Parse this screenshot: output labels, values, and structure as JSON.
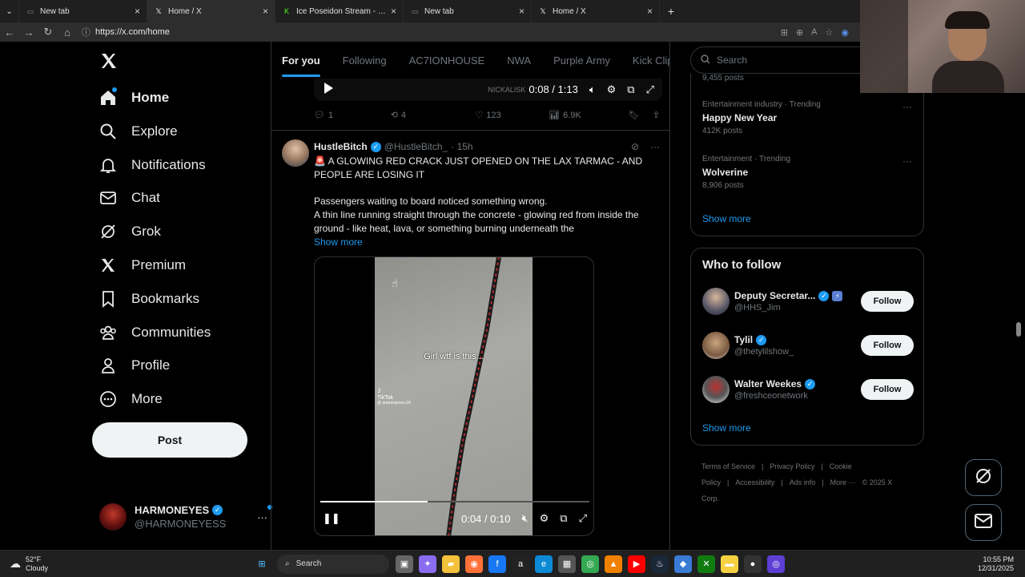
{
  "browser": {
    "tabs": [
      {
        "title": "New tab",
        "active": false,
        "favicon": "page-icon"
      },
      {
        "title": "Home / X",
        "active": true,
        "favicon": "x-logo-icon"
      },
      {
        "title": "Ice Poseidon Stream - Watch Li",
        "active": false,
        "favicon": "kick-icon"
      },
      {
        "title": "New tab",
        "active": false,
        "favicon": "page-icon"
      },
      {
        "title": "Home / X",
        "active": false,
        "favicon": "x-logo-icon"
      }
    ],
    "url": "https://x.com/home"
  },
  "sidebar": {
    "items": [
      {
        "label": "Home",
        "icon": "home-icon",
        "active": true
      },
      {
        "label": "Explore",
        "icon": "search-icon"
      },
      {
        "label": "Notifications",
        "icon": "bell-icon"
      },
      {
        "label": "Chat",
        "icon": "mail-icon"
      },
      {
        "label": "Grok",
        "icon": "grok-icon"
      },
      {
        "label": "Premium",
        "icon": "x-logo-icon"
      },
      {
        "label": "Bookmarks",
        "icon": "bookmark-icon"
      },
      {
        "label": "Communities",
        "icon": "people-icon"
      },
      {
        "label": "Profile",
        "icon": "person-icon"
      },
      {
        "label": "More",
        "icon": "more-circle-icon"
      }
    ],
    "post_label": "Post",
    "account": {
      "name": "HARMONEYES",
      "handle": "@HARMONEYESS",
      "more": "···"
    }
  },
  "feed": {
    "tabs": [
      "For you",
      "Following",
      "AC7IONHOUSE",
      "NWA",
      "Purple Army",
      "Kick Clips"
    ],
    "prev_post": {
      "watermark": "NICKALISK",
      "time": "0:08 / 1:13",
      "replies": "1",
      "reposts": "4",
      "likes": "123",
      "views": "6.9K"
    },
    "post": {
      "author": "HustleBitch",
      "handle": "@HustleBitch_",
      "time": "· 15h",
      "headline": "🚨 A GLOWING RED CRACK JUST OPENED ON THE LAX TARMAC - AND PEOPLE ARE LOSING IT",
      "line1": "Passengers waiting to board noticed something wrong.",
      "line2": "A thin line running straight through the concrete - glowing red from inside the ground - like heat, lava, or something burning underneath the",
      "show_more": "Show more",
      "video": {
        "caption": "Girl wtf is this...",
        "tiktok": "TikTok",
        "tiktok_user": "@ andrewjones.24",
        "time": "0:04 / 0:10",
        "progress": 0.4
      }
    }
  },
  "right": {
    "search_placeholder": "Search",
    "trends_top_count": "9,455 posts",
    "trends": [
      {
        "meta": "Entertainment industry · Trending",
        "name": "Happy New Year",
        "count": "412K posts"
      },
      {
        "meta": "Entertainment · Trending",
        "name": "Wolverine",
        "count": "8,906 posts"
      }
    ],
    "trends_show_more": "Show more",
    "who_to_follow": {
      "title": "Who to follow",
      "people": [
        {
          "name": "Deputy Secretar...",
          "handle": "@HHS_Jim",
          "button": "Follow"
        },
        {
          "name": "Tylil",
          "handle": "@thetylilshow_",
          "button": "Follow"
        },
        {
          "name": "Walter Weekes",
          "handle": "@freshceonetwork",
          "button": "Follow"
        }
      ],
      "show_more": "Show more"
    },
    "footer": [
      "Terms of Service",
      "|",
      "Privacy Policy",
      "|",
      "Cookie Policy",
      "|",
      "Accessibility",
      "|",
      "Ads info",
      "|",
      "More ···",
      "© 2025 X Corp."
    ]
  },
  "taskbar": {
    "weather_temp": "52°F",
    "weather_desc": "Cloudy",
    "search_label": "Search",
    "time": "10:55 PM",
    "date": "12/31/2025"
  }
}
